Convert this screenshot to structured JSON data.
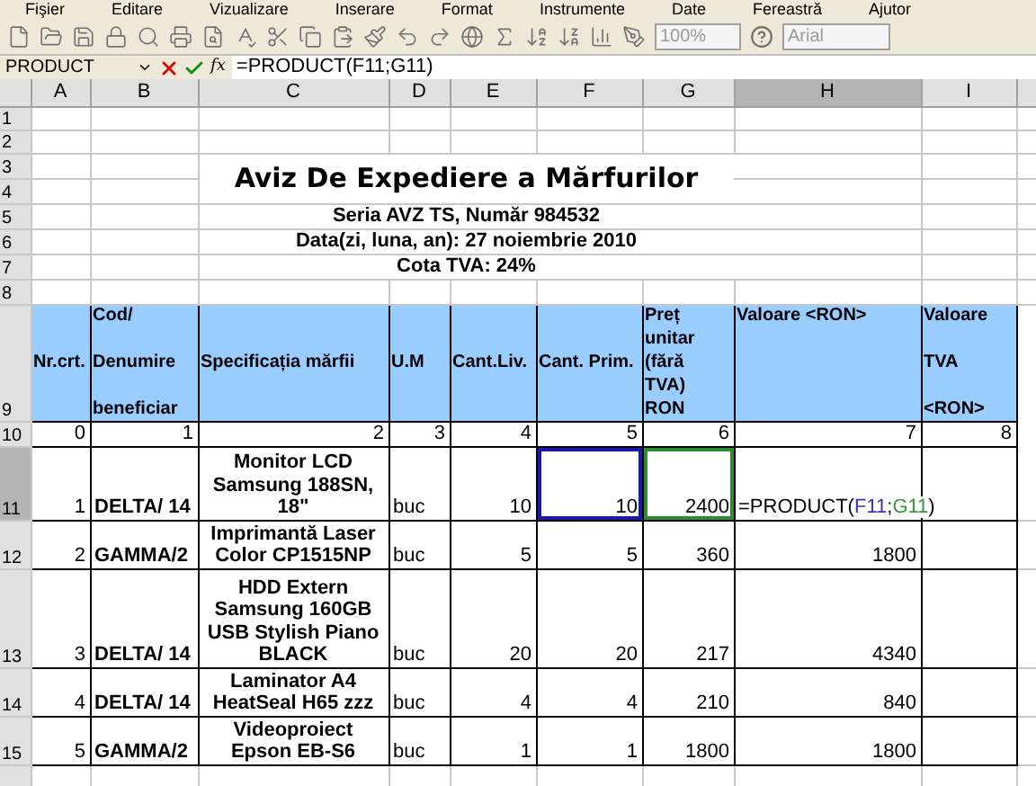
{
  "menu": [
    "Fişier",
    "Editare",
    "Vizualizare",
    "Inserare",
    "Format",
    "Instrumente",
    "Date",
    "Fereastră",
    "Ajutor"
  ],
  "toolbar": {
    "zoom": "100%",
    "font": "Arial"
  },
  "formula_bar": {
    "name_box": "PRODUCT",
    "function_label": "fx",
    "formula": "=PRODUCT(F11;G11)"
  },
  "columns": [
    {
      "label": "A",
      "selected": false
    },
    {
      "label": "B",
      "selected": false
    },
    {
      "label": "C",
      "selected": false
    },
    {
      "label": "D",
      "selected": false
    },
    {
      "label": "E",
      "selected": false
    },
    {
      "label": "F",
      "selected": false
    },
    {
      "label": "G",
      "selected": false
    },
    {
      "label": "H",
      "selected": true
    },
    {
      "label": "I",
      "selected": false
    }
  ],
  "row_headers": [
    {
      "label": "1",
      "selected": false
    },
    {
      "label": "2",
      "selected": false
    },
    {
      "label": "3",
      "selected": false
    },
    {
      "label": "4",
      "selected": false
    },
    {
      "label": "5",
      "selected": false
    },
    {
      "label": "6",
      "selected": false
    },
    {
      "label": "7",
      "selected": false
    },
    {
      "label": "8",
      "selected": false
    },
    {
      "label": "9",
      "selected": false
    },
    {
      "label": "10",
      "selected": false
    },
    {
      "label": "11",
      "selected": true
    },
    {
      "label": "12",
      "selected": false
    },
    {
      "label": "13",
      "selected": false
    },
    {
      "label": "14",
      "selected": false
    },
    {
      "label": "15",
      "selected": false
    }
  ],
  "document": {
    "title": "Aviz De Expediere a Mărfurilor",
    "lines": [
      "Seria AVZ TS, Număr 984532",
      "Data(zi, luna, an): 27 noiembrie 2010",
      "Cota TVA: 24%"
    ]
  },
  "table": {
    "headers": [
      {
        "lines": [
          "Nr.crt."
        ]
      },
      {
        "lines": [
          "Cod/",
          "Denumire",
          "beneficiar"
        ]
      },
      {
        "lines": [
          "Specificația mărfii"
        ]
      },
      {
        "lines": [
          "U.M"
        ]
      },
      {
        "lines": [
          "Cant.Liv."
        ]
      },
      {
        "lines": [
          "Cant. Prim."
        ]
      },
      {
        "lines": [
          "Preț",
          "unitar",
          "(fără",
          "TVA)",
          "RON"
        ]
      },
      {
        "lines": [
          "Valoare <RON>"
        ]
      },
      {
        "lines": [
          "Valoare",
          "TVA",
          "<RON>"
        ]
      }
    ],
    "index_row": [
      "0",
      "1",
      "2",
      "3",
      "4",
      "5",
      "6",
      "7",
      "8"
    ],
    "rows": [
      {
        "cells": [
          "1",
          "DELTA/ 14",
          "Monitor LCD Samsung 188SN, 18\"",
          "buc",
          "10",
          {
            "text": "10",
            "color": "#1a1aa6"
          },
          {
            "text": "2400",
            "color": "#2e8b2e"
          },
          {
            "parts": [
              {
                "text": "=PRODUCT("
              },
              {
                "text": "F11",
                "color": "#3333cc"
              },
              {
                "text": ";"
              },
              {
                "text": "G11",
                "color": "#339933"
              },
              {
                "text": ")"
              }
            ]
          },
          ""
        ]
      },
      {
        "cells": [
          "2",
          "GAMMA/2",
          "Imprimantă Laser Color CP1515NP",
          "buc",
          "5",
          "5",
          "360",
          "1800",
          ""
        ]
      },
      {
        "cells": [
          "3",
          "DELTA/ 14",
          "HDD Extern Samsung 160GB USB Stylish Piano BLACK",
          "buc",
          "20",
          "20",
          "217",
          "4340",
          ""
        ]
      },
      {
        "cells": [
          "4",
          "DELTA/ 14",
          "Laminator A4 HeatSeal H65 zzz",
          "buc",
          "4",
          "4",
          "210",
          "840",
          ""
        ]
      },
      {
        "cells": [
          "5",
          "GAMMA/2",
          "Videoproiect Epson EB-S6",
          "buc",
          "1",
          "1",
          "1800",
          "1800",
          ""
        ]
      }
    ]
  }
}
